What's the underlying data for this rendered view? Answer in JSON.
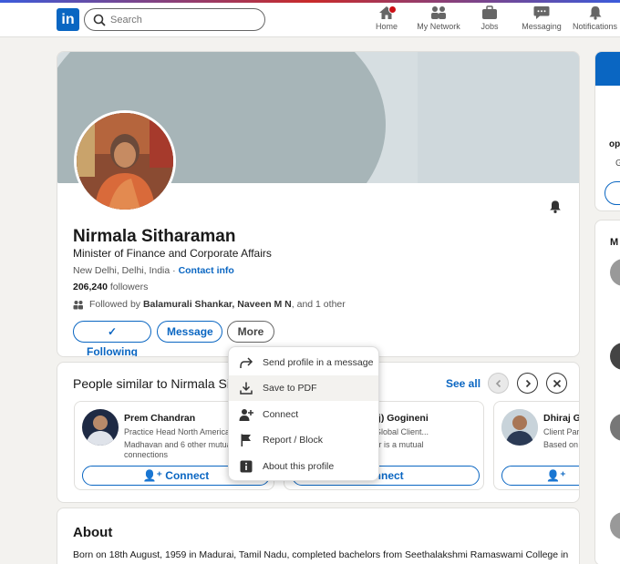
{
  "nav": {
    "search_placeholder": "Search",
    "items": [
      {
        "label": "Home",
        "icon": "home-icon"
      },
      {
        "label": "My Network",
        "icon": "network-icon"
      },
      {
        "label": "Jobs",
        "icon": "briefcase-icon"
      },
      {
        "label": "Messaging",
        "icon": "chat-icon"
      },
      {
        "label": "Notifications",
        "icon": "bell-icon"
      }
    ]
  },
  "profile": {
    "name": "Nirmala Sitharaman",
    "headline": "Minister of Finance and Corporate Affairs",
    "location": "New Delhi, Delhi, India",
    "separator": " · ",
    "contact_info": "Contact info",
    "followers_count": "206,240",
    "followers_label": " followers",
    "followed_prefix": "Followed by ",
    "followed_names": "Balamurali Shankar, Naveen M N",
    "followed_suffix": ", and 1 other",
    "following_label": "Following",
    "message_label": "Message",
    "more_label": "More"
  },
  "more_menu": [
    {
      "label": "Send profile in a message",
      "icon": "share-icon"
    },
    {
      "label": "Save to PDF",
      "icon": "download-icon"
    },
    {
      "label": "Connect",
      "icon": "add-person-icon"
    },
    {
      "label": "Report / Block",
      "icon": "flag-icon"
    },
    {
      "label": "About this profile",
      "icon": "info-icon"
    }
  ],
  "similar": {
    "title": "People similar to Nirmala Sitharaman",
    "see_all": "See all",
    "people": [
      {
        "name": "Prem Chandran",
        "title": "Practice Head North America",
        "mutual": "Madhavan and 6 other mutual connections",
        "connect": "Connect"
      },
      {
        "name": "(Raj) Gogineni",
        "title": "ri - Global Client...",
        "mutual": "umar is a mutual",
        "mutual2": "tion",
        "connect": "onnect"
      },
      {
        "name": "Dhiraj Gu",
        "title": "Client Par",
        "mutual": "Based on",
        "connect": ""
      }
    ]
  },
  "about": {
    "title": "About",
    "text": "Born on 18th August, 1959 in Madurai, Tamil Nadu, completed bachelors from Seethalakshmi Ramaswami College in"
  },
  "rail": {
    "text1": "op",
    "text2": "G",
    "text3": "M"
  },
  "colors": {
    "brand": "#0a66c2",
    "badge": "#cc1016"
  }
}
